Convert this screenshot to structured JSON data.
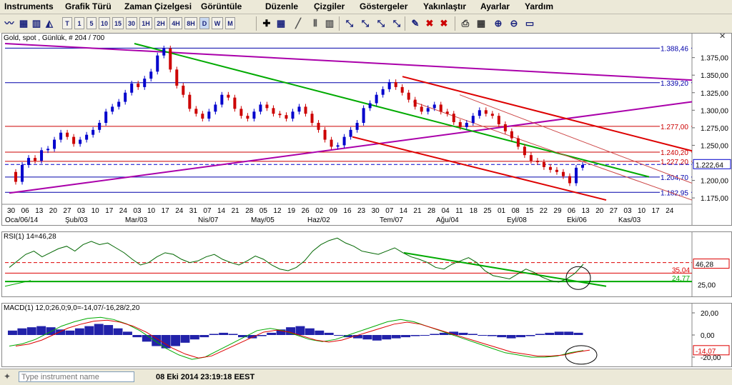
{
  "menu": [
    "Instruments",
    "Grafik Türü",
    "Zaman Çizelgesi",
    "Görüntüle",
    "Düzenle",
    "Çizgiler",
    "Göstergeler",
    "Yakınlaştır",
    "Ayarlar",
    "Yardım"
  ],
  "timeframes": [
    "T",
    "1",
    "5",
    "10",
    "15",
    "30",
    "1H",
    "2H",
    "4H",
    "8H",
    "D",
    "W",
    "M"
  ],
  "toolbar_icons": [
    "line-chart-icon",
    "grid-icon",
    "bar-chart-icon",
    "candlestick-icon",
    "area-chart-icon",
    "crosshair-icon",
    "line-tool-icon",
    "pencil-icon",
    "delete-icon",
    "print-icon",
    "zoom-in-icon",
    "zoom-out-icon",
    "zoom-fit-icon"
  ],
  "close_glyph": "✕",
  "pin_glyph": "✦",
  "chart_title": "Gold, spot , Günlük, # 204 / 700",
  "chart_data": [
    {
      "type": "candlestick",
      "title": "Gold, spot , Günlük, # 204 / 700",
      "y_ticks": [
        "1.375,00",
        "1.350,00",
        "1.325,00",
        "1.300,00",
        "1.275,00",
        "1.250,00",
        "1.225,00",
        "1.200,00",
        "1.175,00"
      ],
      "ylim": [
        1170,
        1395
      ],
      "x_day_ticks": [
        "30",
        "06",
        "13",
        "20",
        "27",
        "03",
        "10",
        "17",
        "24",
        "03",
        "10",
        "17",
        "24",
        "31",
        "07",
        "14",
        "21",
        "28",
        "05",
        "12",
        "19",
        "26",
        "02",
        "09",
        "16",
        "23",
        "30",
        "07",
        "14",
        "21",
        "28",
        "04",
        "11",
        "18",
        "25",
        "01",
        "08",
        "15",
        "22",
        "29",
        "06",
        "13",
        "20",
        "27",
        "03",
        "10",
        "17",
        "24"
      ],
      "x_month_ticks": [
        "Oca/06/14",
        "Şub/03",
        "Mar/03",
        "Nis/07",
        "May/05",
        "Haz/02",
        "Tem/07",
        "Ağu/04",
        "Eyl/08",
        "Eki/06",
        "Kas/03"
      ],
      "horizontal_levels": [
        {
          "label": "1.388,46",
          "value": 1388.46,
          "color": "#0000aa"
        },
        {
          "label": "1.339,20",
          "value": 1339.2,
          "color": "#0000aa"
        },
        {
          "label": "1.277,00",
          "value": 1277.0,
          "color": "#cc0000"
        },
        {
          "label": "1.240,20",
          "value": 1240.2,
          "color": "#cc0000"
        },
        {
          "label": "1.227,20",
          "value": 1227.2,
          "color": "#cc0000"
        },
        {
          "label": "1.204,70",
          "value": 1204.7,
          "color": "#0000aa"
        },
        {
          "label": "1.182,95",
          "value": 1182.95,
          "color": "#0000aa"
        }
      ],
      "current_price": {
        "label": "1.222,64",
        "value": 1222.64
      },
      "series_path": [
        1212,
        1198,
        1222,
        1232,
        1228,
        1243,
        1245,
        1258,
        1268,
        1262,
        1252,
        1258,
        1265,
        1272,
        1282,
        1298,
        1305,
        1312,
        1325,
        1338,
        1333,
        1345,
        1355,
        1378,
        1388,
        1358,
        1335,
        1322,
        1302,
        1295,
        1288,
        1298,
        1308,
        1322,
        1318,
        1302,
        1292,
        1288,
        1298,
        1308,
        1303,
        1295,
        1293,
        1288,
        1298,
        1305,
        1295,
        1282,
        1272,
        1258,
        1248,
        1250,
        1262,
        1272,
        1282,
        1303,
        1310,
        1322,
        1330,
        1340,
        1333,
        1325,
        1315,
        1305,
        1298,
        1303,
        1308,
        1298,
        1295,
        1283,
        1276,
        1282,
        1292,
        1300,
        1295,
        1292,
        1280,
        1270,
        1260,
        1248,
        1236,
        1228,
        1226,
        1219,
        1215,
        1212,
        1206,
        1196,
        1218,
        1222
      ]
    },
    {
      "type": "line",
      "title": "RSI(1) 14=46,28",
      "levels": [
        {
          "label": "35,04",
          "value": 35.04
        },
        {
          "label": "24,77",
          "value": 24.77
        }
      ],
      "y_ticks": [
        "25,00"
      ],
      "current": "46,28",
      "values": [
        42,
        50,
        58,
        62,
        55,
        60,
        65,
        68,
        62,
        70,
        74,
        70,
        72,
        66,
        60,
        52,
        45,
        48,
        55,
        60,
        58,
        52,
        48,
        50,
        55,
        58,
        52,
        48,
        45,
        50,
        56,
        52,
        45,
        40,
        38,
        42,
        50,
        62,
        70,
        75,
        78,
        72,
        68,
        62,
        60,
        58,
        62,
        66,
        60,
        55,
        52,
        48,
        42,
        40,
        46,
        50,
        54,
        48,
        38,
        32,
        30,
        28,
        34,
        40,
        36,
        30,
        26,
        24,
        28,
        35,
        46
      ]
    },
    {
      "type": "bar",
      "title": "MACD(1) 12,0;26,0;9,0=-14,07/-16,28/2,20",
      "y_ticks": [
        "20,00",
        "0,00",
        "-20,00"
      ],
      "current": "-14,07",
      "histogram": [
        4,
        6,
        7,
        8,
        7,
        5,
        4,
        6,
        8,
        10,
        9,
        6,
        3,
        -2,
        -6,
        -10,
        -12,
        -10,
        -7,
        -4,
        -2,
        1,
        2,
        1,
        -2,
        -3,
        -1,
        2,
        5,
        7,
        8,
        6,
        4,
        2,
        0,
        -2,
        -3,
        -4,
        -5,
        -4,
        -3,
        -2,
        -1,
        0,
        1,
        2,
        3,
        2,
        1,
        0,
        -1,
        -2,
        -3,
        -2,
        -1,
        1,
        2,
        3,
        3,
        2
      ]
    }
  ],
  "rsi_header": "RSI(1) 14=46,28",
  "macd_header": "MACD(1) 12,0;26,0;9,0=-14,07/-16,28/2,20",
  "rsi_label_35": "35,04",
  "rsi_label_2477": "24,77",
  "rsi_label_25": "25,00",
  "rsi_current": "46,28",
  "macd_20": "20,00",
  "macd_0": "0,00",
  "macd_m20": "-20,00",
  "macd_current": "-14,07",
  "search_placeholder": "Type instrument name",
  "status_time": "08 Eki 2014 23:19:18 EEST",
  "colors": {
    "green": "#00aa00",
    "red": "#dd0000",
    "purple": "#aa00aa",
    "blue": "#0000cc",
    "rsi": "#006600"
  }
}
